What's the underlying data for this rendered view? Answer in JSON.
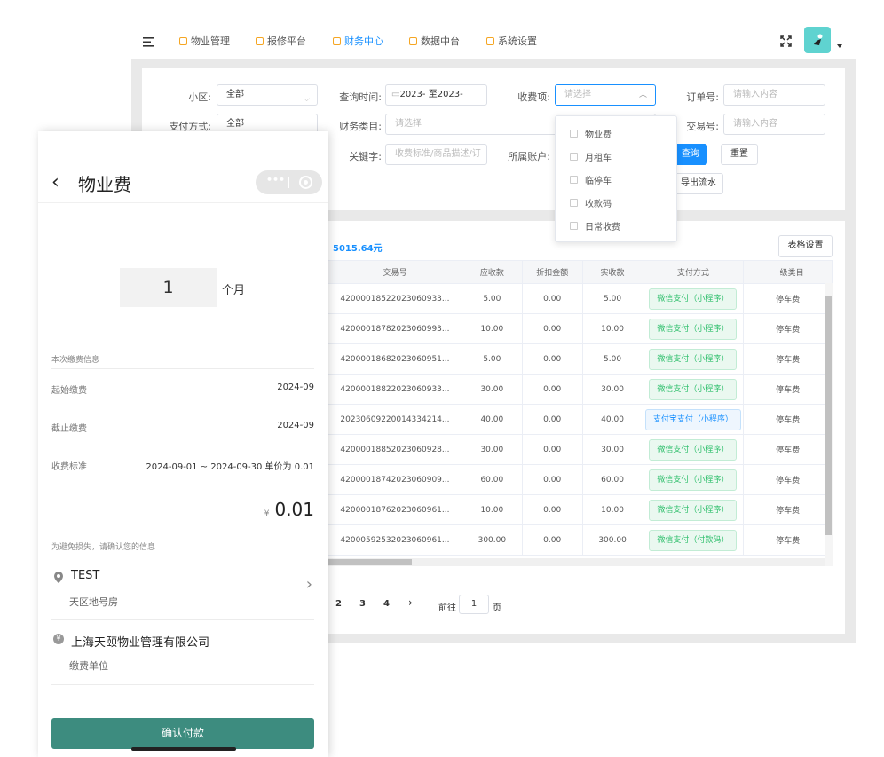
{
  "nav": {
    "tabs": [
      "物业管理",
      "报修平台",
      "财务中心",
      "数据中台",
      "系统设置"
    ],
    "active": 2
  },
  "filters": {
    "community_label": "小区:",
    "community_value": "全部",
    "query_time_label": "查询时间:",
    "date_start": "2023-",
    "date_sep": "至",
    "date_end": "2023-",
    "fee_item_label": "收费项:",
    "fee_item_placeholder": "请选择",
    "order_no_label": "订单号:",
    "order_no_placeholder": "请输入内容",
    "pay_method_label": "支付方式:",
    "pay_method_value": "全部",
    "finance_category_label": "财务类目:",
    "finance_category_placeholder": "请选择",
    "trade_no_label": "交易号:",
    "trade_no_placeholder": "请输入内容",
    "keyword_label": "关键字:",
    "keyword_placeholder": "收费标准/商品描述/订",
    "account_label": "所属账户:",
    "query_button": "查询",
    "reset_button": "重置",
    "export_button": "导出流水"
  },
  "dropdown": {
    "options": [
      "物业费",
      "月租车",
      "临停车",
      "收款码",
      "日常收费"
    ]
  },
  "summary": {
    "total": "5015.64元",
    "table_settings_button": "表格设置"
  },
  "table": {
    "columns": [
      "交易号",
      "应收款",
      "折扣金额",
      "实收款",
      "支付方式",
      "一级类目"
    ],
    "rows": [
      [
        "42000018522023060933...",
        "5.00",
        "0.00",
        "5.00",
        "微信支付（小程序）",
        "停车费"
      ],
      [
        "42000018782023060993...",
        "10.00",
        "0.00",
        "10.00",
        "微信支付（小程序）",
        "停车费"
      ],
      [
        "42000018682023060951...",
        "5.00",
        "0.00",
        "5.00",
        "微信支付（小程序）",
        "停车费"
      ],
      [
        "42000018822023060933...",
        "30.00",
        "0.00",
        "30.00",
        "微信支付（小程序）",
        "停车费"
      ],
      [
        "20230609220014334214...",
        "40.00",
        "0.00",
        "40.00",
        "支付宝支付（小程序）",
        "停车费"
      ],
      [
        "42000018852023060928...",
        "30.00",
        "0.00",
        "30.00",
        "微信支付（小程序）",
        "停车费"
      ],
      [
        "42000018742023060909...",
        "60.00",
        "0.00",
        "60.00",
        "微信支付（小程序）",
        "停车费"
      ],
      [
        "42000018762023060961...",
        "10.00",
        "0.00",
        "10.00",
        "微信支付（小程序）",
        "停车费"
      ],
      [
        "42000592532023060961...",
        "300.00",
        "0.00",
        "300.00",
        "微信支付（付款码）",
        "停车费"
      ]
    ]
  },
  "pagination": {
    "pages": [
      "2",
      "3",
      "4"
    ],
    "next": "›",
    "goto_label": "前往",
    "goto_value": "1",
    "page_suffix": "页"
  },
  "mobile": {
    "title": "物业费",
    "month_count": "1",
    "month_unit": "个月",
    "section_info": "本次缴费信息",
    "start_label": "起始缴费",
    "start_value": "2024-09",
    "end_label": "截止缴费",
    "end_value": "2024-09",
    "standard_label": "收费标准",
    "standard_value": "2024-09-01 ~ 2024-09-30 单价为 0.01",
    "currency": "¥",
    "amount": "0.01",
    "confirm_notice": "为避免损失，请确认您的信息",
    "house_name": "TEST",
    "house_sub": "天区地号房",
    "company_name": "上海天颐物业管理有限公司",
    "company_sub": "缴费单位",
    "pay_button": "确认付款"
  },
  "colors": {
    "primary": "#1890ff",
    "wechat_green": "#2fbf6c",
    "mobile_button": "#3d8c7f"
  }
}
